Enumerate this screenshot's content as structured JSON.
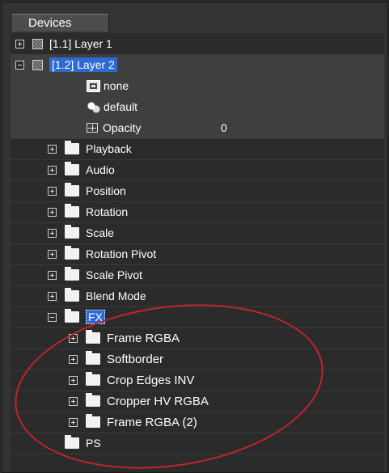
{
  "panel": {
    "tab_label": "Devices"
  },
  "tree": {
    "layer1": {
      "label": "[1.1] Layer 1"
    },
    "layer2": {
      "label": "[1.2] Layer 2"
    },
    "none_item": {
      "label": "none"
    },
    "default_item": {
      "label": "default"
    },
    "opacity": {
      "label": "Opacity",
      "value": "0"
    },
    "groups": [
      {
        "label": "Playback"
      },
      {
        "label": "Audio"
      },
      {
        "label": "Position"
      },
      {
        "label": "Rotation"
      },
      {
        "label": "Scale"
      },
      {
        "label": "Rotation Pivot"
      },
      {
        "label": "Scale Pivot"
      },
      {
        "label": "Blend Mode"
      }
    ],
    "fx": {
      "label": "FX"
    },
    "fx_items": [
      {
        "label": "Frame RGBA"
      },
      {
        "label": "Softborder"
      },
      {
        "label": "Crop Edges INV"
      },
      {
        "label": "Cropper HV RGBA"
      },
      {
        "label": "Frame RGBA (2)"
      }
    ],
    "ps": {
      "label": "PS"
    }
  },
  "colors": {
    "selection": "#2d6ad1",
    "annotation": "#c0252a",
    "background": "#2b2b2b"
  }
}
